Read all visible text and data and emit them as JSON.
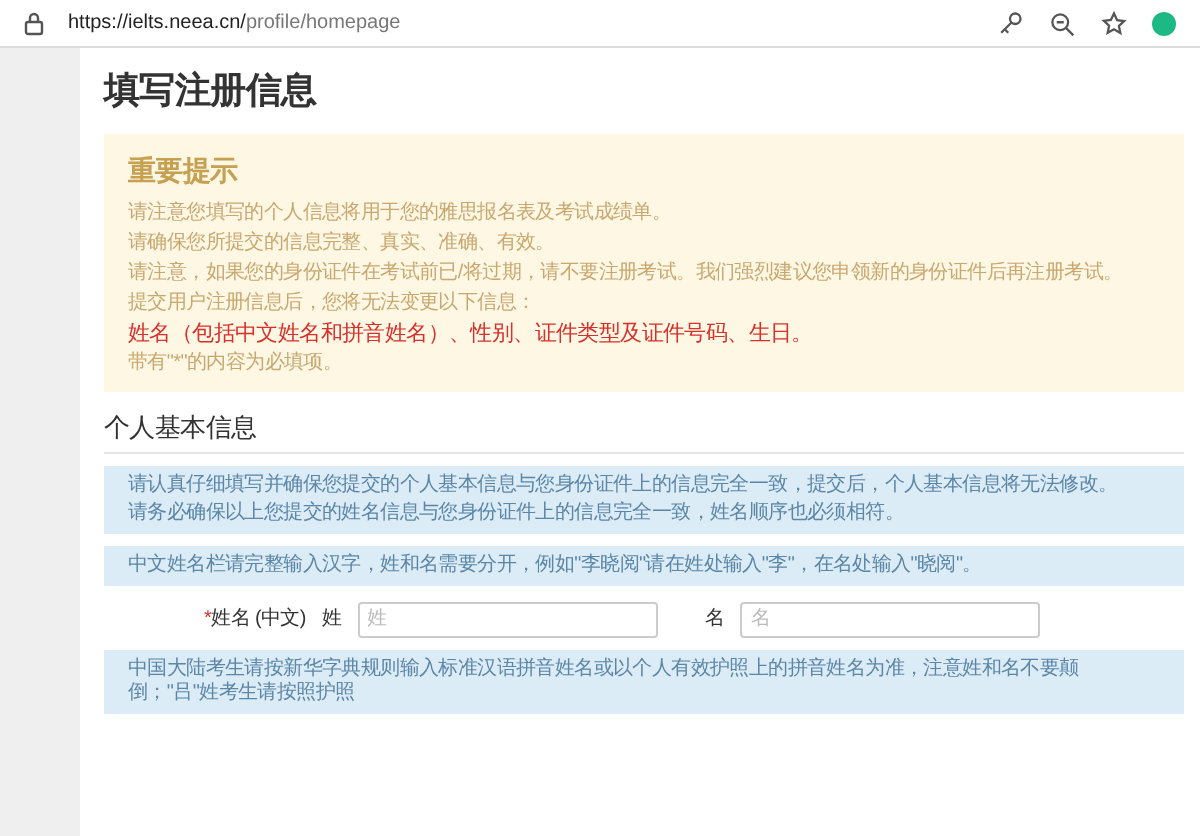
{
  "browser": {
    "url_host": "https://ielts.neea.cn/",
    "url_path": "profile/homepage"
  },
  "page_title": "填写注册信息",
  "notice": {
    "title": "重要提示",
    "lines": [
      {
        "kind": "plain",
        "text": "请注意您填写的个人信息将用于您的雅思报名表及考试成绩单。"
      },
      {
        "kind": "plain",
        "text": "请确保您所提交的信息完整、真实、准确、有效。"
      },
      {
        "kind": "plain",
        "text": "请注意，如果您的身份证件在考试前已/将过期，请不要注册考试。我们强烈建议您申领新的身份证件后再注册考试。"
      },
      {
        "kind": "plain",
        "text": "提交用户注册信息后，您将无法变更以下信息："
      },
      {
        "kind": "alert",
        "text": "姓名（包括中文姓名和拼音姓名）、性别、证件类型及证件号码、生日。"
      },
      {
        "kind": "plain",
        "text": "带有\"*\"的内容为必填项。"
      }
    ]
  },
  "section_title": "个人基本信息",
  "info_boxes": [
    {
      "lines": [
        "请认真仔细填写并确保您提交的个人基本信息与您身份证件上的信息完全一致，提交后，个人基本信息将无法修改。",
        "请务必确保以上您提交的姓名信息与您身份证件上的信息完全一致，姓名顺序也必须相符。"
      ]
    },
    {
      "lines": [
        "中文姓名栏请完整输入汉字，姓和名需要分开，例如\"李晓阅\"请在姓处输入\"李\"，在名处输入\"晓阅\"。"
      ]
    }
  ],
  "name_row": {
    "required_mark": "*",
    "label": "姓名 (中文)",
    "fields": [
      {
        "label": "姓",
        "placeholder": "姓"
      },
      {
        "label": "名",
        "placeholder": "名"
      }
    ]
  },
  "bottom_box": {
    "lines": [
      "中国大陆考生请按新华字典规则输入标准汉语拼音姓名或以个人有效护照上的拼音姓名为准，注意姓和名不要颠倒；\"吕\"姓考生请按照护照"
    ]
  }
}
